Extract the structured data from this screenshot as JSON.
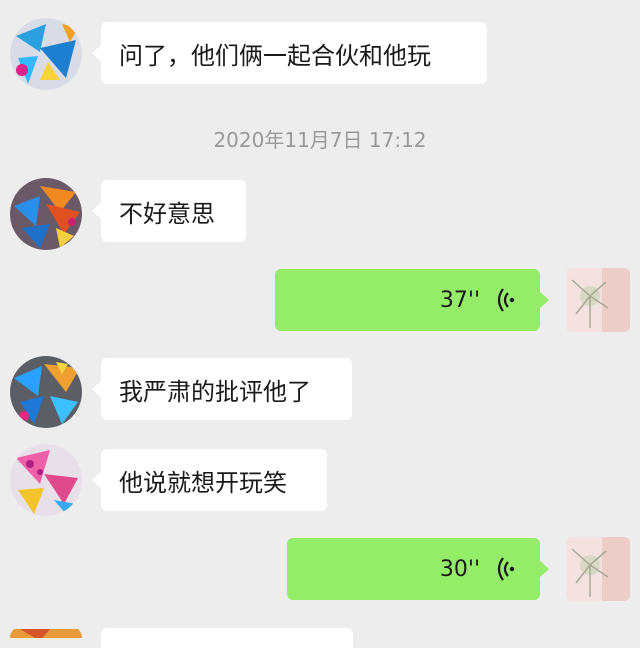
{
  "messages": [
    {
      "direction": "incoming",
      "text": "问了，他们俩一起合伙和他玩"
    },
    {
      "type": "timestamp",
      "text": "2020年11月7日 17:12"
    },
    {
      "direction": "incoming",
      "text": "不好意思"
    },
    {
      "direction": "outgoing",
      "type": "voice",
      "duration": "37''"
    },
    {
      "direction": "incoming",
      "text": "我严肃的批评他了"
    },
    {
      "direction": "incoming",
      "text": "他说就想开玩笑"
    },
    {
      "direction": "outgoing",
      "type": "voice",
      "duration": "30''"
    }
  ],
  "colors": {
    "background": "#ededed",
    "incoming_bubble": "#ffffff",
    "outgoing_bubble": "#95ec69",
    "timestamp_text": "#999999"
  },
  "icons": {
    "voice": "voice-wave-icon",
    "contact_avatar": "contact-avatar",
    "self_avatar": "self-avatar"
  }
}
